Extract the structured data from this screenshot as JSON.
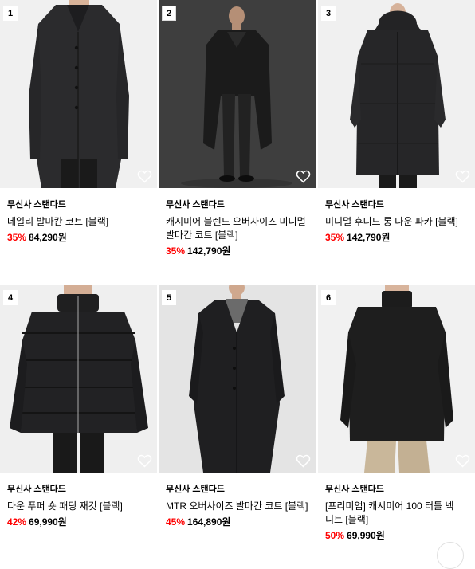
{
  "colors": {
    "discount": "#ff0000",
    "text": "#000000",
    "bg": "#ffffff"
  },
  "products": [
    {
      "rank": "1",
      "brand": "무신사 스탠다드",
      "name": "데일리 발마칸 코트 [블랙]",
      "discount": "35%",
      "price": "84,290원",
      "icon": "heart-outline-icon"
    },
    {
      "rank": "2",
      "brand": "무신사 스탠다드",
      "name": "캐시미어 블렌드 오버사이즈 미니멀 발마칸 코트 [블랙]",
      "discount": "35%",
      "price": "142,790원",
      "icon": "heart-outline-icon"
    },
    {
      "rank": "3",
      "brand": "무신사 스탠다드",
      "name": "미니멀 후디드 롱 다운 파카 [블랙]",
      "discount": "35%",
      "price": "142,790원",
      "icon": "heart-outline-icon"
    },
    {
      "rank": "4",
      "brand": "무신사 스탠다드",
      "name": "다운 푸퍼 숏 패딩 재킷 [블랙]",
      "discount": "42%",
      "price": "69,990원",
      "icon": "heart-outline-icon"
    },
    {
      "rank": "5",
      "brand": "무신사 스탠다드",
      "name": "MTR 오버사이즈 발마칸 코트 [블랙]",
      "discount": "45%",
      "price": "164,890원",
      "icon": "heart-outline-icon"
    },
    {
      "rank": "6",
      "brand": "무신사 스탠다드",
      "name": "[프리미엄] 캐시미어 100 터틀 넥 니트 [블랙]",
      "discount": "50%",
      "price": "69,990원",
      "icon": "heart-outline-icon"
    }
  ]
}
